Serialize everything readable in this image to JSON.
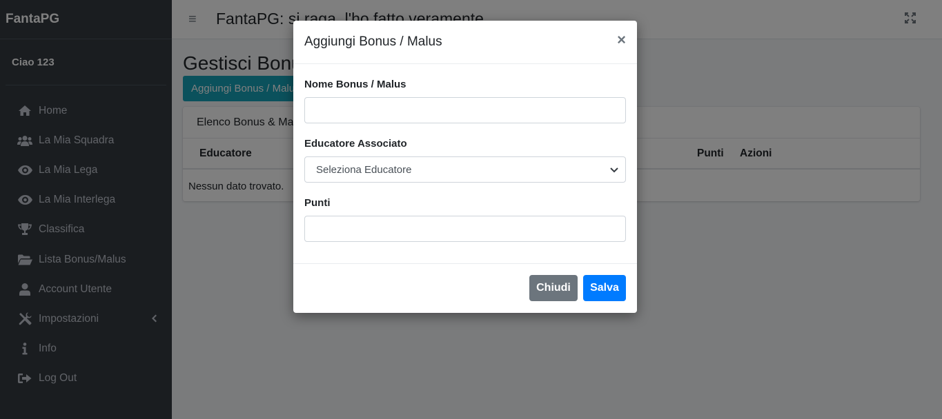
{
  "sidebar": {
    "brand": "FantaPG",
    "user": "Ciao 123",
    "items": [
      {
        "label": "Home",
        "icon": "home-icon"
      },
      {
        "label": "La Mia Squadra",
        "icon": "users-icon"
      },
      {
        "label": "La Mia Lega",
        "icon": "eye-icon"
      },
      {
        "label": "La Mia Interlega",
        "icon": "eye-icon"
      },
      {
        "label": "Classifica",
        "icon": "trophy-icon"
      },
      {
        "label": "Lista Bonus/Malus",
        "icon": "folder-open-icon"
      },
      {
        "label": "Account Utente",
        "icon": "user-icon"
      },
      {
        "label": "Impostazioni",
        "icon": "tools-icon"
      },
      {
        "label": "Info",
        "icon": "info-icon"
      },
      {
        "label": "Log Out",
        "icon": "sign-out-icon"
      }
    ]
  },
  "topbar": {
    "title": "FantaPG: si raga, l'ho fatto veramente"
  },
  "page": {
    "title": "Gestisci Bonus",
    "add_button": "Aggiungi Bonus / Malus",
    "card_header": "Elenco Bonus & Malus",
    "table_headers": {
      "educatore": "Educatore",
      "punti": "Punti",
      "azioni": "Azioni"
    },
    "empty_text": "Nessun dato trovato."
  },
  "modal": {
    "title": "Aggiungi Bonus / Malus",
    "close": "×",
    "fields": {
      "nome_label": "Nome Bonus / Malus",
      "nome_value": "",
      "educatore_label": "Educatore Associato",
      "educatore_selected": "Seleziona Educatore",
      "punti_label": "Punti",
      "punti_value": ""
    },
    "buttons": {
      "close": "Chiudi",
      "save": "Salva"
    }
  },
  "colors": {
    "sidebar_bg": "#343a40",
    "info": "#17a2b8",
    "primary": "#007bff",
    "secondary": "#6c757d"
  }
}
